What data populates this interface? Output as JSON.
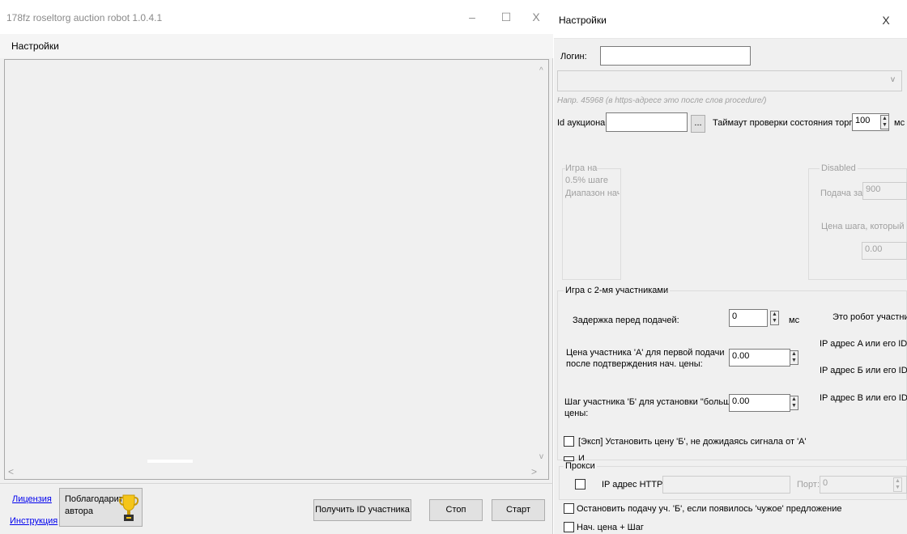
{
  "main_window": {
    "title": "178fz roseltorg auction robot 1.0.4.1",
    "controls": {
      "minimize": "–",
      "maximize": "☐",
      "close": "X"
    },
    "menu": {
      "settings": "Настройки"
    },
    "footer": {
      "license_link": "Лицензия",
      "instructions_link": "Инструкция",
      "thank_button": "Поблагодарить автора",
      "get_id_button": "Получить ID участника",
      "stop_button": "Стоп",
      "start_button": "Старт"
    }
  },
  "settings_window": {
    "title": "Настройки",
    "close": "X",
    "login_label": "Логин:",
    "login_value": "",
    "hint": "Напр. 45968 (в https-адресе это после слов procedure/)",
    "auction_id_label": "Id аукциона:",
    "auction_id_value": "",
    "browse_button": "...",
    "timeout_label": "Таймаут проверки состояния торгов:",
    "timeout_value": "100",
    "timeout_unit": "мс",
    "half_step_group": {
      "line1": "Игра на",
      "line2": "0.5% шаге",
      "line3": "Диапазон нача"
    },
    "disabled_group": {
      "title": "Disabled",
      "submit_label": "Подача за",
      "submit_value": "900",
      "step_price_label": "Цена шага, который нужн",
      "step_price_value": "0.00"
    },
    "two_players_group": {
      "title": "Игра с 2-мя участниками",
      "delay_label": "Задержка перед подачей:",
      "delay_value": "0",
      "delay_unit": "мс",
      "robot_label": "Это робот участника",
      "price_a_label_1": "Цена участника 'А' для первой подачи",
      "price_a_label_2": "после подтверждения нач. цены:",
      "price_a_value": "0.00",
      "step_b_label_1": "Шаг участника 'Б' для установки \"большой\"",
      "step_b_label_2": "цены:",
      "step_b_value": "0.00",
      "ip_a_label": "IP адрес A или его ID",
      "ip_b_label": "IP адрес Б или его ID",
      "ip_v_label": "IP адрес В или его ID",
      "exp_checkbox_label": "[Эксп] Установить цену 'Б', не дожидаясь сигнала от 'А'",
      "partial_checkbox_label": "И"
    },
    "proxy_group": {
      "title": "Прокси",
      "http_label": "IP адрес HTTP:",
      "http_value": "",
      "port_label": "Порт:",
      "port_value": "0"
    },
    "stop_b_checkbox_label": "Остановить подачу уч. 'Б', если появилось 'чужое' предложение",
    "start_price_checkbox_label": "Нач. цена + Шаг"
  }
}
